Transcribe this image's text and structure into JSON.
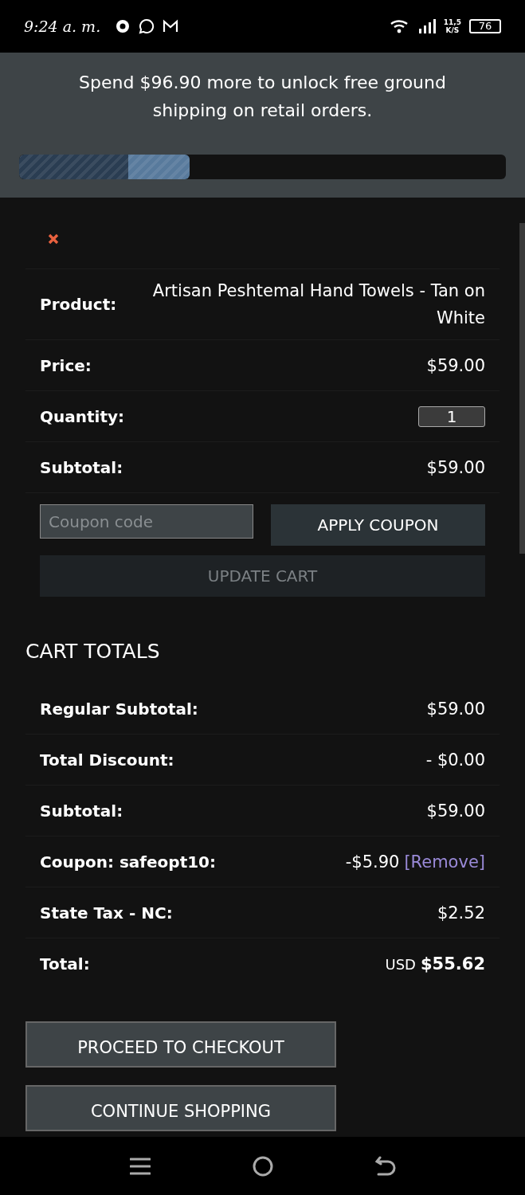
{
  "status_bar": {
    "time": "9:24 a. m.",
    "network_speed": "11,5",
    "speed_unit": "K/S",
    "battery": "76"
  },
  "banner": {
    "message": "Spend $96.90 more to unlock free ground shipping on retail orders.",
    "progress": {
      "level": 0.35
    }
  },
  "cart_item": {
    "rows": [
      {
        "kind": "text",
        "label": "Product:",
        "value": "Artisan Peshtemal Hand Towels - Tan on White"
      },
      {
        "kind": "text",
        "label": "Price:",
        "value": "$59.00"
      },
      {
        "kind": "quantity",
        "label": "Quantity:",
        "value": "1"
      },
      {
        "kind": "text",
        "label": "Subtotal:",
        "value": "$59.00"
      }
    ]
  },
  "coupon": {
    "placeholder": "Coupon code",
    "apply_button": "APPLY COUPON"
  },
  "update_button": {
    "label": "UPDATE CART",
    "disabled": true
  },
  "cart_totals": {
    "title": "CART TOTALS",
    "rows": [
      {
        "kind": "plain",
        "label": "Regular Subtotal:",
        "value": "$59.00"
      },
      {
        "kind": "plain",
        "label": "Total Discount:",
        "value": "- $0.00"
      },
      {
        "kind": "plain",
        "label": "Subtotal:",
        "value": "$59.00"
      },
      {
        "kind": "coupon",
        "label": "Coupon: safeopt10:",
        "value": "-$5.90",
        "link": "[Remove]"
      },
      {
        "kind": "plain",
        "label": "State Tax - NC:",
        "value": "$2.52"
      },
      {
        "kind": "total",
        "label": "Total:",
        "currency": "USD",
        "value": "$55.62"
      }
    ]
  },
  "buttons": [
    "PROCEED TO CHECKOUT",
    "CONTINUE SHOPPING"
  ]
}
